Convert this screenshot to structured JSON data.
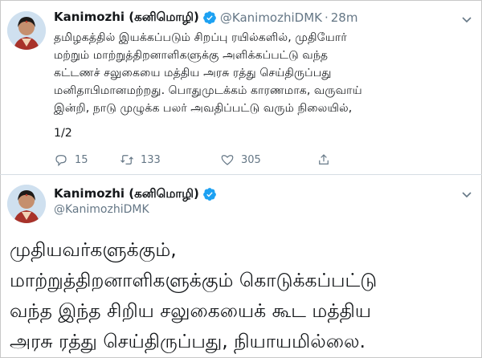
{
  "tweet1": {
    "author_name": "Kanimozhi (கனிமொழி)",
    "handle": "@KanimozhiDMK",
    "separator": "·",
    "time": "28m",
    "text": "தமிழகத்தில் இயக்கப்படும் சிறப்பு ரயில்களில், முதியோர்\nமற்றும் மாற்றுத்திறனாளிகளுக்கு அளிக்கப்பட்டு வந்த\nகட்டணச் சலுகையை மத்திய அரசு ரத்து செய்திருப்பது\nமனிதாபிமானமற்றது. பொதுமுடக்கம் காரணமாக, வருவாய்\nஇன்றி, நாடு முழுக்க பலர் அவதிப்பட்டு வரும் நிலையில்,",
    "thread_index": "1/2",
    "reply_count": "15",
    "retweet_count": "133",
    "like_count": "305"
  },
  "tweet2": {
    "author_name": "Kanimozhi (கனிமொழி)",
    "handle": "@KanimozhiDMK",
    "text": "முதியவர்களுக்கும்,\nமாற்றுத்திறனாளிகளுக்கும் கொடுக்கப்பட்டு\nவந்த இந்த சிறிய சலுகையைக் கூட மத்திய\nஅரசு ரத்து செய்திருப்பது, நியாயமில்லை."
  },
  "icons": {
    "verified": "verified-badge-icon",
    "caret": "chevron-down-icon",
    "reply": "reply-icon",
    "retweet": "retweet-icon",
    "like": "heart-icon",
    "share": "share-icon"
  },
  "colors": {
    "verified": "#1da1f2",
    "muted": "#657786",
    "text": "#14171a"
  }
}
